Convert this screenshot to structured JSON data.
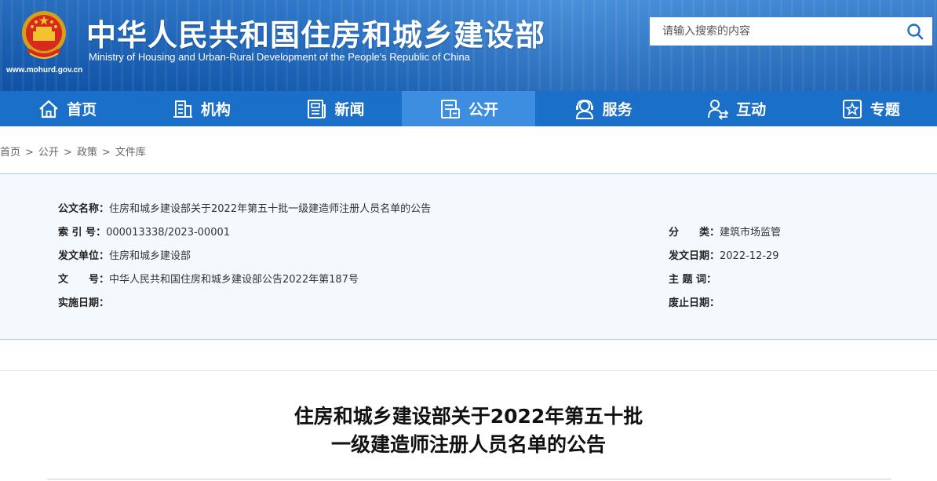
{
  "header": {
    "title": "中华人民共和国住房和城乡建设部",
    "subtitle": "Ministry of Housing and Urban-Rural Development of the People's Republic of China",
    "url": "www.mohurd.gov.cn",
    "emblem_icon": "national-emblem-icon"
  },
  "search": {
    "placeholder": "请输入搜索的内容",
    "icon": "search-icon"
  },
  "nav": {
    "items": [
      {
        "label": "首页",
        "icon": "home-icon"
      },
      {
        "label": "机构",
        "icon": "building-icon"
      },
      {
        "label": "新闻",
        "icon": "newspaper-icon"
      },
      {
        "label": "公开",
        "icon": "public-info-icon"
      },
      {
        "label": "服务",
        "icon": "service-person-icon"
      },
      {
        "label": "互动",
        "icon": "interaction-icon"
      },
      {
        "label": "专题",
        "icon": "star-topic-icon"
      }
    ],
    "active_index": 3
  },
  "breadcrumb": {
    "items": [
      "首页",
      "公开",
      "政策",
      "文件库"
    ],
    "separator": ">"
  },
  "info": {
    "doc_name_label": "公文名称：",
    "doc_name_value": "住房和城乡建设部关于2022年第五十批一级建造师注册人员名单的公告",
    "index_label": "索 引 号：",
    "index_value": "000013338/2023-00001",
    "category_label": "分　　类：",
    "category_value": "建筑市场监管",
    "issuer_label": "发文单位：",
    "issuer_value": "住房和城乡建设部",
    "date_label": "发文日期：",
    "date_value": "2022-12-29",
    "number_label": "文　　号：",
    "number_value": "中华人民共和国住房和城乡建设部公告2022年第187号",
    "keywords_label": "主 题 词：",
    "keywords_value": "",
    "effective_label": "实施日期：",
    "effective_value": "",
    "expiry_label": "废止日期：",
    "expiry_value": ""
  },
  "article": {
    "title_line1": "住房和城乡建设部关于2022年第五十批",
    "title_line2": "一级建造师注册人员名单的公告"
  },
  "colors": {
    "header_blue": "#1d6cc4",
    "nav_blue": "#1a6fc9",
    "nav_active": "#3d8ee0",
    "info_bg": "#f4f9fd",
    "info_border": "#a9cce8"
  }
}
